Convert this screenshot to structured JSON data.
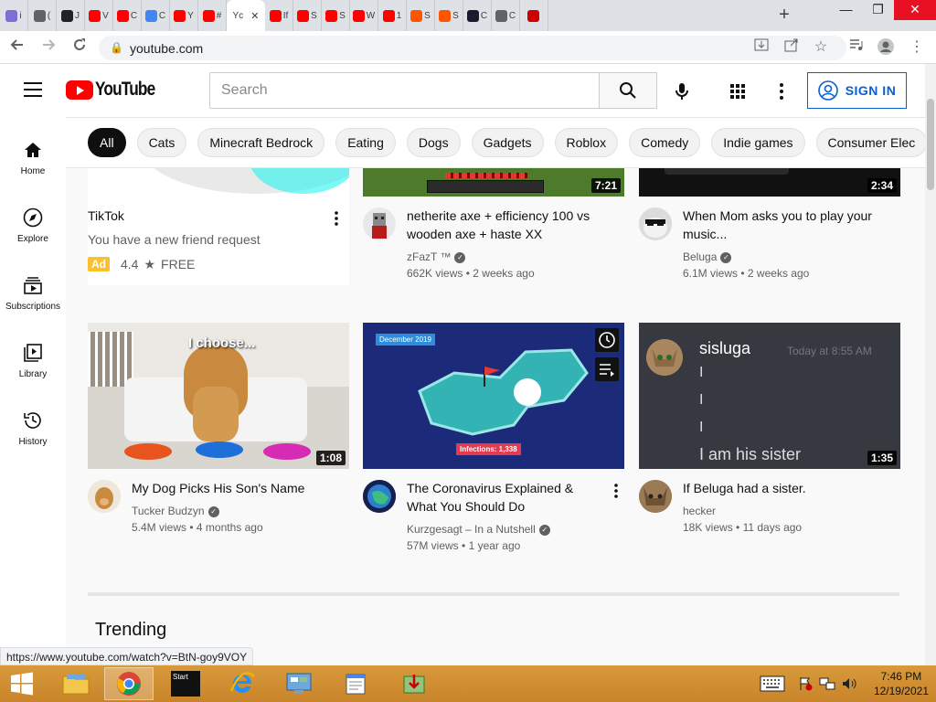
{
  "browser": {
    "tabs": [
      {
        "letter": "i",
        "color": "#7b6fd6"
      },
      {
        "letter": "(",
        "color": "#5f6368"
      },
      {
        "letter": "J",
        "color": "#202124"
      },
      {
        "letter": "V",
        "color": "#ff0000"
      },
      {
        "letter": "C",
        "color": "#ff0000"
      },
      {
        "letter": "C",
        "color": "#4285f4"
      },
      {
        "letter": "Y",
        "color": "#ff0000"
      },
      {
        "letter": "#",
        "color": "#ff0000"
      },
      {
        "letter": "Yc",
        "color": "",
        "active": true
      },
      {
        "letter": "If",
        "color": "#ff0000"
      },
      {
        "letter": "S",
        "color": "#ff0000"
      },
      {
        "letter": "S",
        "color": "#ff0000"
      },
      {
        "letter": "W",
        "color": "#ff0000"
      },
      {
        "letter": "1",
        "color": "#ff0000"
      },
      {
        "letter": "S",
        "color": "#ff5500"
      },
      {
        "letter": "S",
        "color": "#ff5500"
      },
      {
        "letter": "C",
        "color": "#1a1a2e"
      },
      {
        "letter": "C",
        "color": "#5f6368"
      },
      {
        "letter": "",
        "color": "#cc0000"
      }
    ],
    "new_tab": "+",
    "window": {
      "minimize": "—",
      "restore": "❐",
      "close": "✕"
    },
    "url": "youtube.com",
    "status_url": "https://www.youtube.com/watch?v=BtN-goy9VOY"
  },
  "header": {
    "logo_text": "YouTube",
    "search_placeholder": "Search",
    "signin_label": "SIGN IN"
  },
  "chips": [
    "All",
    "Cats",
    "Minecraft Bedrock",
    "Eating",
    "Dogs",
    "Gadgets",
    "Roblox",
    "Comedy",
    "Indie games",
    "Consumer Elec"
  ],
  "sidebar": [
    {
      "label": "Home",
      "icon": "home-icon"
    },
    {
      "label": "Explore",
      "icon": "compass-icon"
    },
    {
      "label": "Subscriptions",
      "icon": "subscriptions-icon"
    },
    {
      "label": "Library",
      "icon": "library-icon"
    },
    {
      "label": "History",
      "icon": "history-icon"
    }
  ],
  "ad": {
    "title": "TikTok",
    "desc": "You have a new friend request",
    "badge": "Ad",
    "rating": "4.4",
    "star": "★",
    "price": "FREE"
  },
  "row1": [
    {
      "title": "netherite axe + efficiency 100 vs wooden axe + haste XX",
      "channel": "zFazT ™",
      "views": "662K views",
      "age": "2 weeks ago",
      "duration": "7:21"
    },
    {
      "title": "When Mom asks you to play your music...",
      "channel": "Beluga",
      "views": "6.1M views",
      "age": "2 weeks ago",
      "duration": "2:34"
    }
  ],
  "row2": [
    {
      "title": "My Dog Picks His Son's Name",
      "channel": "Tucker Budzyn",
      "views": "5.4M views",
      "age": "4 months ago",
      "duration": "1:08",
      "thumb_text": "I choose..."
    },
    {
      "title": "The Coronavirus Explained & What You Should Do",
      "channel": "Kurzgesagt – In a Nutshell",
      "views": "57M views",
      "age": "1 year ago",
      "thumb_badge": "December 2019",
      "thumb_caption": "Infections: 1,338"
    },
    {
      "title": "If Beluga had a sister.",
      "channel": "hecker",
      "views": "18K views",
      "age": "11 days ago",
      "duration": "1:35",
      "chat_name": "sisluga",
      "chat_time": "Today at 8:55 AM",
      "chat_line": "I",
      "chat_msg": "I am his sister"
    }
  ],
  "meta_sep": "•",
  "section_title": "Trending",
  "taskbar": {
    "time": "7:46 PM",
    "date": "12/19/2021",
    "start_label": "Start"
  }
}
